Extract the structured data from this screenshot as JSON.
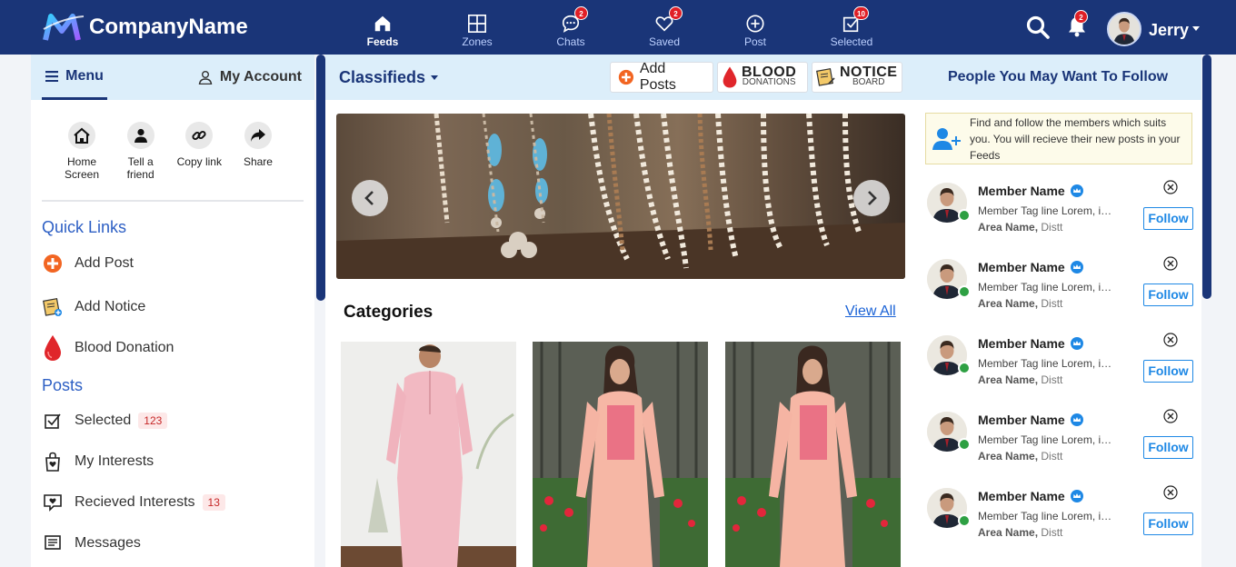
{
  "brand": {
    "name": "CompanyName"
  },
  "nav": [
    {
      "label": "Feeds",
      "icon": "home-icon",
      "badge": null,
      "active": true
    },
    {
      "label": "Zones",
      "icon": "grid-icon",
      "badge": null,
      "active": false
    },
    {
      "label": "Chats",
      "icon": "chat-icon",
      "badge": "2",
      "active": false
    },
    {
      "label": "Saved",
      "icon": "heart-icon",
      "badge": "2",
      "active": false
    },
    {
      "label": "Post",
      "icon": "plus-circle-icon",
      "badge": null,
      "active": false
    },
    {
      "label": "Selected",
      "icon": "checkbox-icon",
      "badge": "10",
      "active": false
    }
  ],
  "header": {
    "notifications_badge": "2",
    "user_name": "Jerry"
  },
  "left": {
    "menu_label": "Menu",
    "account_label": "My Account",
    "quick_actions": [
      {
        "label": "Home Screen",
        "icon": "house-icon"
      },
      {
        "label": "Tell a friend",
        "icon": "person-icon"
      },
      {
        "label": "Copy link",
        "icon": "link-icon"
      },
      {
        "label": "Share",
        "icon": "share-icon"
      }
    ],
    "quick_links_title": "Quick Links",
    "quick_links": [
      {
        "label": "Add Post",
        "icon": "plus-circle-icon"
      },
      {
        "label": "Add Notice",
        "icon": "notice-icon"
      },
      {
        "label": "Blood Donation",
        "icon": "blood-drop-icon"
      }
    ],
    "posts_title": "Posts",
    "posts": [
      {
        "label": "Selected",
        "icon": "checkbox-icon",
        "count": "123"
      },
      {
        "label": "My Interests",
        "icon": "bag-heart-icon",
        "count": null
      },
      {
        "label": "Recieved Interests",
        "icon": "chat-heart-icon",
        "count": "13"
      },
      {
        "label": "Messages",
        "icon": "message-icon",
        "count": null
      }
    ]
  },
  "center": {
    "section": "Classifieds",
    "add_posts_label": "Add Posts",
    "blood_title": "BLOOD",
    "blood_sub": "DONATIONS",
    "notice_title": "NOTICE",
    "notice_sub": "BOARD",
    "categories_title": "Categories",
    "view_all_label": "View All"
  },
  "right": {
    "title": "People You May Want To Follow",
    "info_text": "Find and follow the members which suits you. You will recieve their new posts in your Feeds",
    "follow_label": "Follow",
    "members": [
      {
        "name": "Member Name",
        "tagline": "Member Tag line Lorem, ipsum",
        "area": "Area Name,",
        "district": "Distt"
      },
      {
        "name": "Member Name",
        "tagline": "Member Tag line Lorem, ipsum",
        "area": "Area Name,",
        "district": "Distt"
      },
      {
        "name": "Member Name",
        "tagline": "Member Tag line Lorem, ipsum",
        "area": "Area Name,",
        "district": "Distt"
      },
      {
        "name": "Member Name",
        "tagline": "Member Tag line Lorem, ipsum",
        "area": "Area Name,",
        "district": "Distt"
      },
      {
        "name": "Member Name",
        "tagline": "Member Tag line Lorem, ipsum",
        "area": "Area Name,",
        "district": "Distt"
      }
    ]
  },
  "colors": {
    "topbar": "#1a3578",
    "accent": "#2d5fc4",
    "panel_head": "#dceefa",
    "badge": "#e01f26",
    "online": "#2ea043"
  }
}
